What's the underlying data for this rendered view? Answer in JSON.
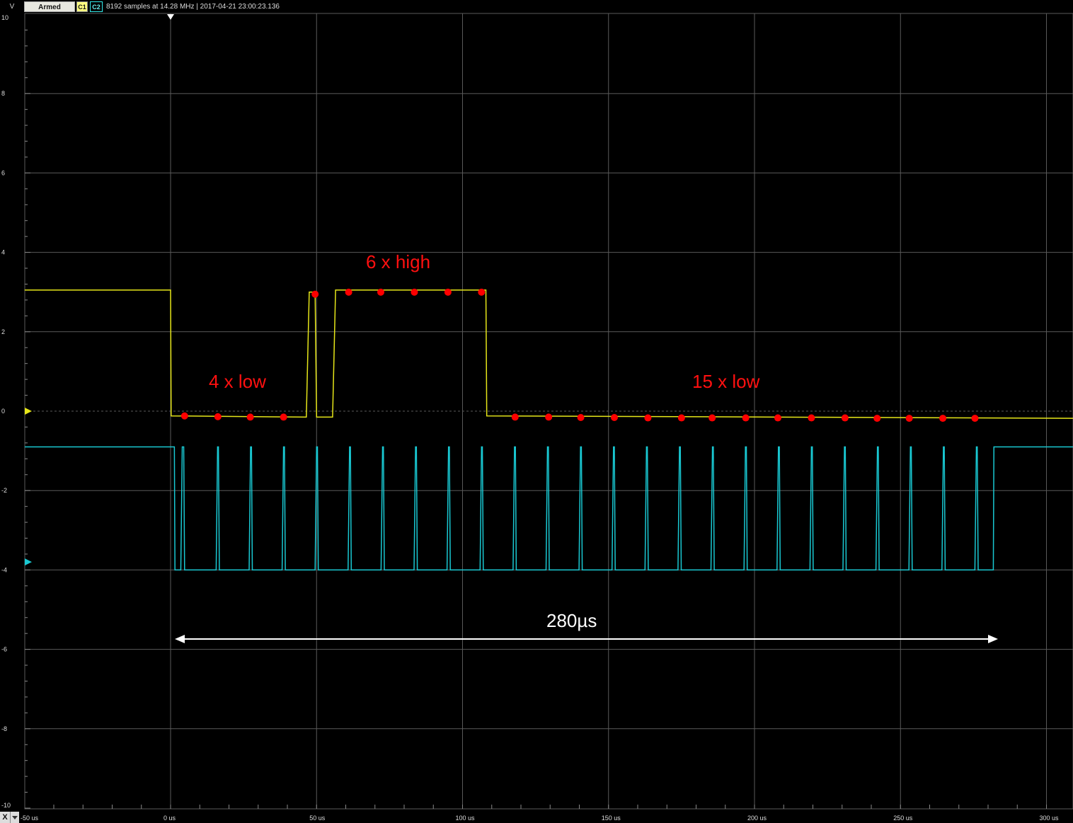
{
  "toolbar": {
    "y_unit": "V",
    "state_label": "Armed",
    "channel1_label": "C1",
    "channel2_label": "C2",
    "status_text": "8192 samples at 14.28 MHz | 2017-04-21 23:00:23.136",
    "x_button_label": "X"
  },
  "colors": {
    "background": "#000000",
    "grid": "#5a5a5a",
    "channel1": "#e6e619",
    "channel2": "#19c8d2",
    "sample_dots": "#ff0000",
    "annotation": "#ff1010",
    "measurement": "#ffffff"
  },
  "axes": {
    "y_ticks": [
      "10",
      "8",
      "6",
      "4",
      "2",
      "0",
      "-2",
      "-4",
      "-6",
      "-8",
      "-10"
    ],
    "x_ticks": [
      "-50 us",
      "0 us",
      "50 us",
      "100 us",
      "150 us",
      "200 us",
      "250 us",
      "300 us"
    ]
  },
  "annotations": {
    "low_first": "4 x low",
    "high": "6 x high",
    "low_second": "15 x low",
    "duration": "280µs"
  },
  "chart_data": {
    "type": "line",
    "xlim": [
      -50,
      310
    ],
    "ylim": [
      -10,
      10
    ],
    "x_unit": "us",
    "y_unit": "V",
    "grid": true,
    "series": [
      {
        "name": "C1",
        "x": [
          -50,
          0,
          0.2,
          46.5,
          47.5,
          49.5,
          50,
          55.5,
          56.5,
          108,
          108.3,
          310
        ],
        "y": [
          3.05,
          3.05,
          -0.12,
          -0.15,
          3.0,
          3.0,
          -0.15,
          -0.15,
          3.05,
          3.05,
          -0.12,
          -0.18
        ]
      },
      {
        "name": "C2",
        "pulse_period_us": 11.3,
        "pulse_count": 26,
        "x": [
          -50,
          1,
          280,
          310
        ],
        "y": [
          -0.9,
          -0.9,
          -0.9,
          -0.9
        ],
        "low_level": -4.0,
        "high_level": -0.9
      }
    ],
    "sample_points": {
      "x": [
        4.8,
        16.2,
        27.3,
        38.7,
        49.5,
        61,
        72,
        83.5,
        95,
        106.5,
        118,
        129.5,
        140.5,
        152,
        163.5,
        175,
        185.5,
        197,
        208,
        219.5,
        231,
        242,
        253,
        264.5,
        275.5
      ],
      "y": [
        -0.12,
        -0.14,
        -0.15,
        -0.15,
        3.0,
        3.05,
        3.05,
        3.05,
        3.05,
        3.05,
        -0.15,
        -0.15,
        -0.16,
        -0.16,
        -0.17,
        -0.17,
        -0.17,
        -0.17,
        -0.17,
        -0.17,
        -0.17,
        -0.18,
        -0.18,
        -0.18,
        -0.18
      ]
    },
    "duration_marker": {
      "from": 0,
      "to": 280
    }
  }
}
